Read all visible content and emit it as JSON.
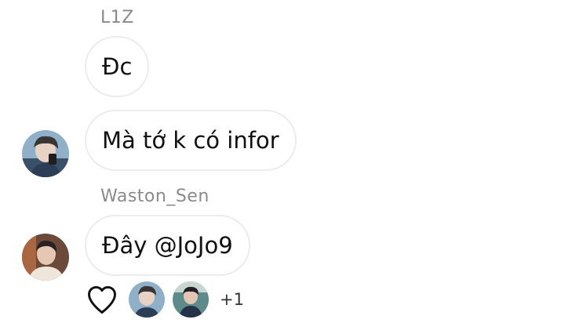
{
  "messages": [
    {
      "sender": "L1Z",
      "text": "Đc"
    },
    {
      "sender": "",
      "text": "Mà tớ k có infor"
    },
    {
      "sender": "Waston_Sen",
      "text": "Đây @JoJo9"
    }
  ],
  "reactions": {
    "icon": "heart-outline-icon",
    "extra_count": "+1"
  },
  "colors": {
    "sender_text": "#8a8a8a",
    "bubble_border": "#ececec",
    "message_text": "#111111"
  }
}
